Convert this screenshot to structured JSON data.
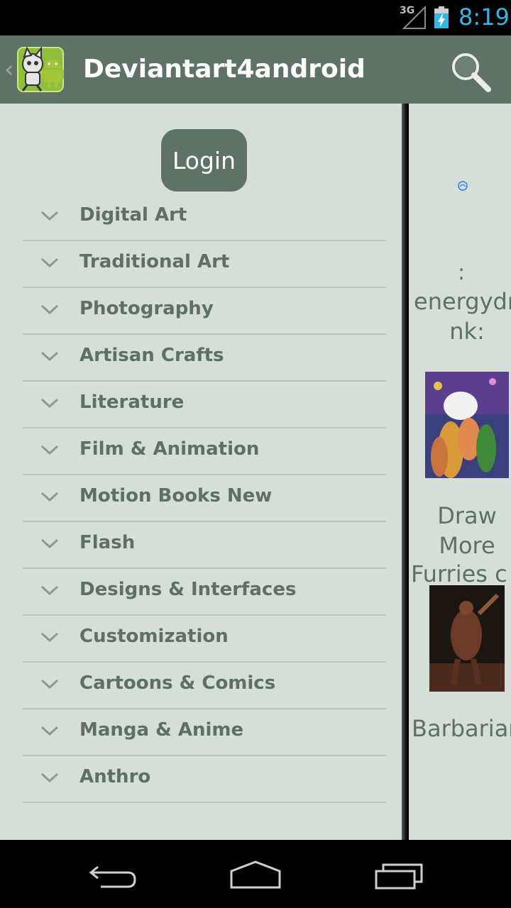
{
  "status_bar": {
    "network": "3G",
    "time": "8:19"
  },
  "action_bar": {
    "title": "Deviantart4android",
    "logo_icon": "deviantart-android-logo-icon",
    "search_icon": "search-icon"
  },
  "drawer": {
    "login_label": "Login",
    "categories": [
      {
        "label": "Digital Art"
      },
      {
        "label": "Traditional Art"
      },
      {
        "label": "Photography"
      },
      {
        "label": "Artisan Crafts"
      },
      {
        "label": "Literature"
      },
      {
        "label": "Film & Animation"
      },
      {
        "label": "Motion Books New"
      },
      {
        "label": "Flash"
      },
      {
        "label": "Designs & Interfaces"
      },
      {
        "label": "Customization"
      },
      {
        "label": "Cartoons & Comics"
      },
      {
        "label": "Manga & Anime"
      },
      {
        "label": "Anthro"
      }
    ]
  },
  "content": {
    "items": [
      {
        "line1": ":",
        "line2": "energydri",
        "line3": "nk:"
      },
      {
        "line1": "Draw",
        "line2": "More",
        "line3": "Furries c"
      },
      {
        "line1": "Barbarian"
      }
    ]
  },
  "nav_bar": {
    "back_icon": "back-icon",
    "home_icon": "home-icon",
    "recents_icon": "recent-apps-icon"
  },
  "colors": {
    "accent": "#5e7366",
    "drawer_bg": "#d5dfd7",
    "text": "#5e6f64",
    "clock": "#33b5e5"
  }
}
